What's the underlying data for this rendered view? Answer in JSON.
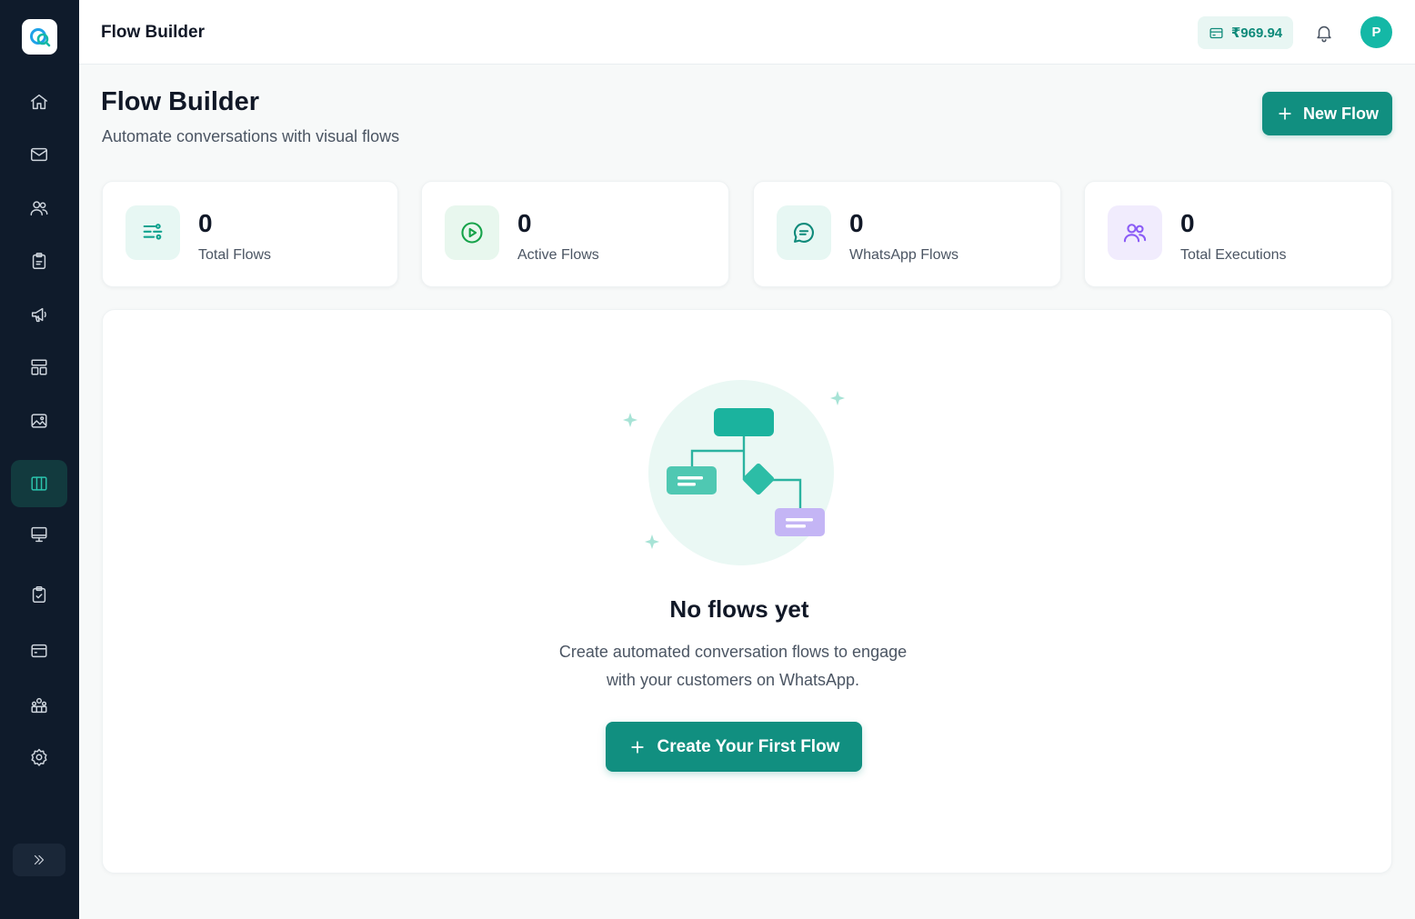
{
  "sidebar": {
    "items": [
      {
        "name": "home-icon"
      },
      {
        "name": "mail-icon"
      },
      {
        "name": "users-icon"
      },
      {
        "name": "clipboard-icon"
      },
      {
        "name": "megaphone-icon"
      },
      {
        "name": "templates-icon"
      },
      {
        "name": "image-icon"
      },
      {
        "name": "flow-builder-icon",
        "active": true
      },
      {
        "name": "monitor-icon"
      },
      {
        "name": "clipboard-check-icon"
      },
      {
        "name": "billing-card-icon"
      },
      {
        "name": "team-icon"
      },
      {
        "name": "settings-icon"
      }
    ],
    "expand_icon": "chevrons-right-icon"
  },
  "topbar": {
    "title": "Flow Builder",
    "balance": "₹969.94",
    "avatar_initial": "P"
  },
  "header": {
    "title": "Flow Builder",
    "subtitle": "Automate conversations with visual flows",
    "new_flow_label": "New Flow"
  },
  "stats": [
    {
      "value": "0",
      "label": "Total Flows",
      "icon": "list-flow-icon",
      "color": "#10a38f",
      "bg": "#e7f7f3"
    },
    {
      "value": "0",
      "label": "Active Flows",
      "icon": "play-circle-icon",
      "color": "#16a34a",
      "bg": "#e8f7ee"
    },
    {
      "value": "0",
      "label": "WhatsApp Flows",
      "icon": "chat-bubble-icon",
      "color": "#0e8a7a",
      "bg": "#e7f7f3"
    },
    {
      "value": "0",
      "label": "Total Executions",
      "icon": "users-icon",
      "color": "#8b5cf6",
      "bg": "#f1ecfd"
    }
  ],
  "empty_state": {
    "title": "No flows yet",
    "description": "Create automated conversation flows to engage with your customers on WhatsApp.",
    "cta_label": "Create Your First Flow"
  },
  "colors": {
    "accent": "#118f80",
    "sidebar_bg": "#0f1b2b",
    "active_icon": "#2bc4ad"
  }
}
